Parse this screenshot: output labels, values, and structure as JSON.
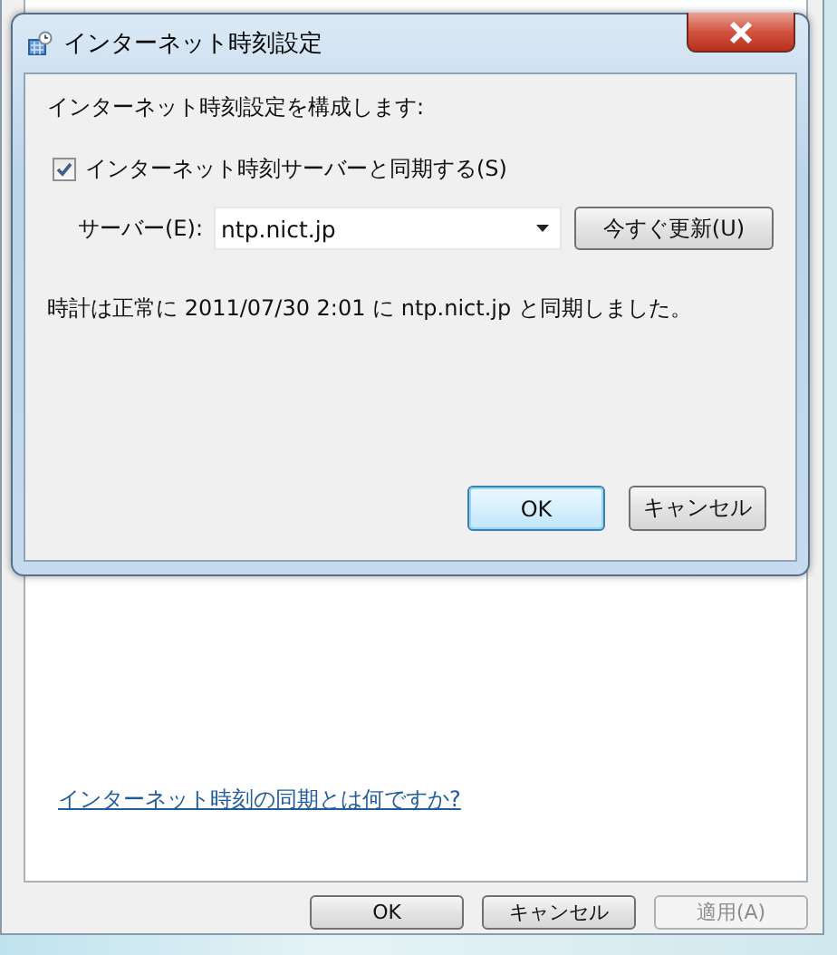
{
  "parent_window": {
    "link": "インターネット時刻の同期とは何ですか?",
    "buttons": [
      {
        "label": "OK",
        "disabled": false
      },
      {
        "label": "キャンセル",
        "disabled": false
      },
      {
        "label": "適用(A)",
        "disabled": true
      }
    ]
  },
  "dialog": {
    "title": "インターネット時刻設定",
    "intro": "インターネット時刻設定を構成します:",
    "sync_checkbox": {
      "label": "インターネット時刻サーバーと同期する(S)",
      "checked": true
    },
    "server_label": "サーバー(E):",
    "server_value": "ntp.nict.jp",
    "update_button": "今すぐ更新(U)",
    "status": "時計は正常に 2011/07/30 2:01 に ntp.nict.jp と同期しました。",
    "buttons": [
      {
        "label": "OK",
        "default": true
      },
      {
        "label": "キャンセル",
        "default": false
      }
    ]
  }
}
